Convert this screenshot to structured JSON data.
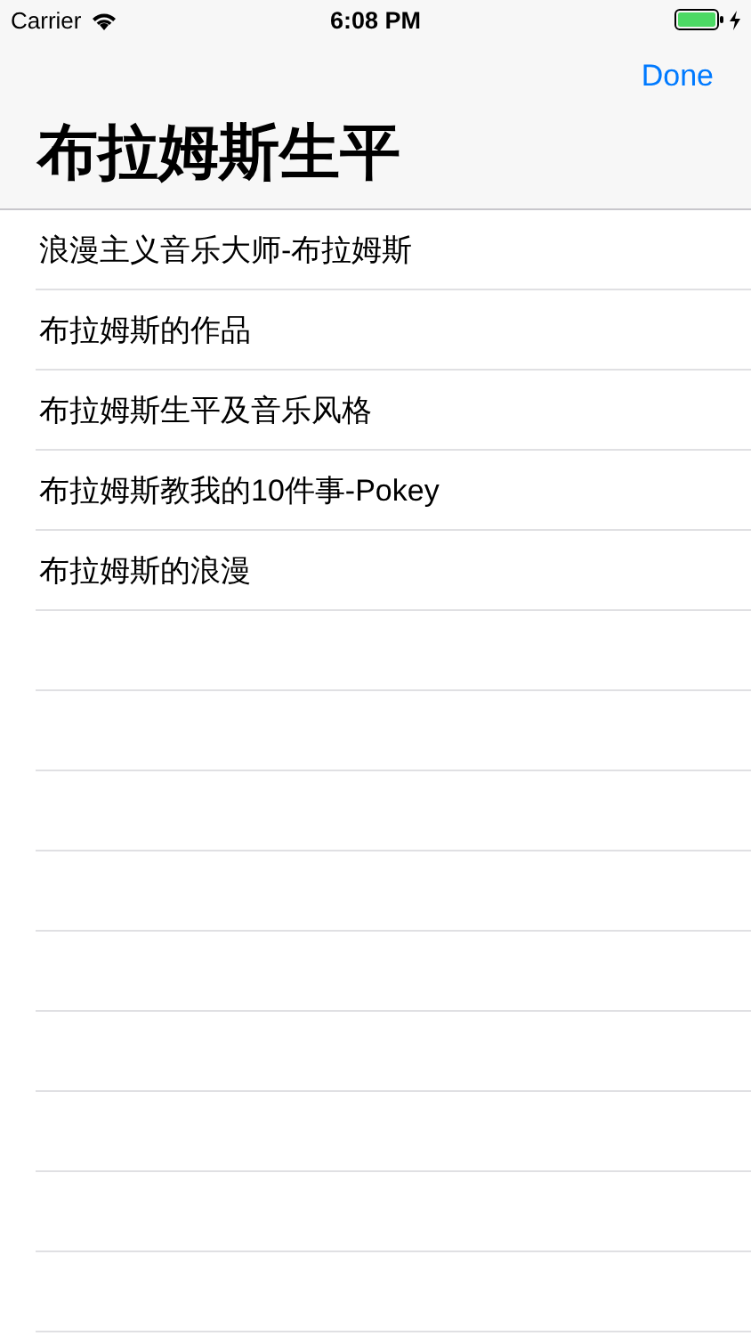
{
  "status_bar": {
    "carrier": "Carrier",
    "time": "6:08 PM"
  },
  "nav_bar": {
    "done": "Done",
    "title": "布拉姆斯生平"
  },
  "items": [
    {
      "label": "浪漫主义音乐大师-布拉姆斯"
    },
    {
      "label": "布拉姆斯的作品"
    },
    {
      "label": "布拉姆斯生平及音乐风格"
    },
    {
      "label": "布拉姆斯教我的10件事-Pokey"
    },
    {
      "label": "布拉姆斯的浪漫"
    }
  ]
}
